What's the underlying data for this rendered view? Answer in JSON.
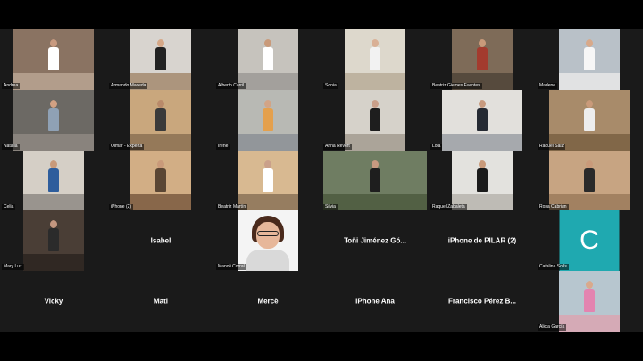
{
  "meeting": {
    "background_color": "#1a1a1a",
    "avatar_color": "#1fa9b0"
  },
  "participants": [
    {
      "name": "Andrea",
      "kind": "video",
      "wall": "#8a7362",
      "floor": "#b9a593",
      "shirt": "#ffffff",
      "skin": "#c89a80"
    },
    {
      "name": "Armando Maceda",
      "kind": "video",
      "wall": "#d8d4cf",
      "floor": "#a58a6e",
      "shirt": "#222222",
      "skin": "#d6a888"
    },
    {
      "name": "Alberto Carril",
      "kind": "video",
      "wall": "#c6c3bd",
      "floor": "#9c9a96",
      "shirt": "#ffffff",
      "skin": "#c99a7a"
    },
    {
      "name": "Sonia",
      "kind": "video",
      "wall": "#ddd8cc",
      "floor": "#b9ad98",
      "shirt": "#f2f2f2",
      "skin": "#d9b096"
    },
    {
      "name": "Beatriz Giemes Fuentes",
      "kind": "video",
      "wall": "#7e6b58",
      "floor": "#4f4438",
      "shirt": "#a33b2e",
      "skin": "#c99a7a"
    },
    {
      "name": "Marlene",
      "kind": "video",
      "wall": "#b9c1c8",
      "floor": "#e7e7e7",
      "shirt": "#f6f6f6",
      "skin": "#d8a98a"
    },
    {
      "name": "Natalia",
      "kind": "video",
      "wall": "#6c6964",
      "floor": "#8e8881",
      "shirt": "#8fa1b5",
      "skin": "#d2a183"
    },
    {
      "name": "Olmar - Experta",
      "kind": "video",
      "wall": "#c9a77d",
      "floor": "#8c7152",
      "shirt": "#3a3a3a",
      "skin": "#b98a6a"
    },
    {
      "name": "Irene",
      "kind": "video",
      "wall": "#b8b9b4",
      "floor": "#8b8f95",
      "shirt": "#e4a04d",
      "skin": "#d2a486"
    },
    {
      "name": "Anna Revert",
      "kind": "video",
      "wall": "#d6d2ca",
      "floor": "#a39c90",
      "shirt": "#1e1e1e",
      "skin": "#caa08a"
    },
    {
      "name": "Lola",
      "kind": "video",
      "wall": "#e2e0dc",
      "floor": "#9b9fa5",
      "shirt": "#252a33",
      "skin": "#c79a7f"
    },
    {
      "name": "Raquel Sáiz",
      "kind": "video",
      "wall": "#a88b6a",
      "floor": "#7a6042",
      "shirt": "#ededed",
      "skin": "#c99a7a"
    },
    {
      "name": "Celia",
      "kind": "video",
      "wall": "#d5cfc6",
      "floor": "#8e8a84",
      "shirt": "#2e5d9c",
      "skin": "#c99a7a"
    },
    {
      "name": "iPhone (2)",
      "kind": "video",
      "wall": "#d2ae85",
      "floor": "#7b5a3f",
      "shirt": "#5a4634",
      "skin": "#c99a7a"
    },
    {
      "name": "Beatriz Martín",
      "kind": "video",
      "wall": "#d8b991",
      "floor": "#8b7257",
      "shirt": "#ffffff",
      "skin": "#caa08a"
    },
    {
      "name": "Silvia",
      "kind": "video",
      "wall": "#6f7d62",
      "floor": "#4d5a3f",
      "shirt": "#1e1e1e",
      "skin": "#c69a80"
    },
    {
      "name": "Raquel Zabaleta",
      "kind": "video",
      "wall": "#e3e2de",
      "floor": "#b7b4ae",
      "shirt": "#1b1b1b",
      "skin": "#c99a7a"
    },
    {
      "name": "Rosa Cabrian",
      "kind": "video",
      "wall": "#c7a482",
      "floor": "#9b7b5c",
      "shirt": "#2a2a2a",
      "skin": "#c99a7a"
    },
    {
      "name": "Mary Luz",
      "kind": "video",
      "wall": "#4a3e36",
      "floor": "#2b2420",
      "shirt": "#2b2b2b",
      "skin": "#c49780"
    },
    {
      "name": "Isabel",
      "kind": "name"
    },
    {
      "name": "Manoli Corral",
      "kind": "photo"
    },
    {
      "name": "Toñi Jiménez Gó...",
      "kind": "name"
    },
    {
      "name": "iPhone de PILAR (2)",
      "kind": "name"
    },
    {
      "name": "Catalina Solís",
      "kind": "avatar",
      "initial": "C"
    },
    {
      "name": "Vicky",
      "kind": "name"
    },
    {
      "name": "Mati",
      "kind": "name"
    },
    {
      "name": "Mercè",
      "kind": "name"
    },
    {
      "name": "iPhone Ana",
      "kind": "name"
    },
    {
      "name": "Francisco Pérez B...",
      "kind": "name"
    },
    {
      "name": "Alicia García",
      "kind": "video",
      "wall": "#b7c6cf",
      "floor": "#dba4b2",
      "shirt": "#e384b0",
      "skin": "#d9a98c"
    }
  ]
}
